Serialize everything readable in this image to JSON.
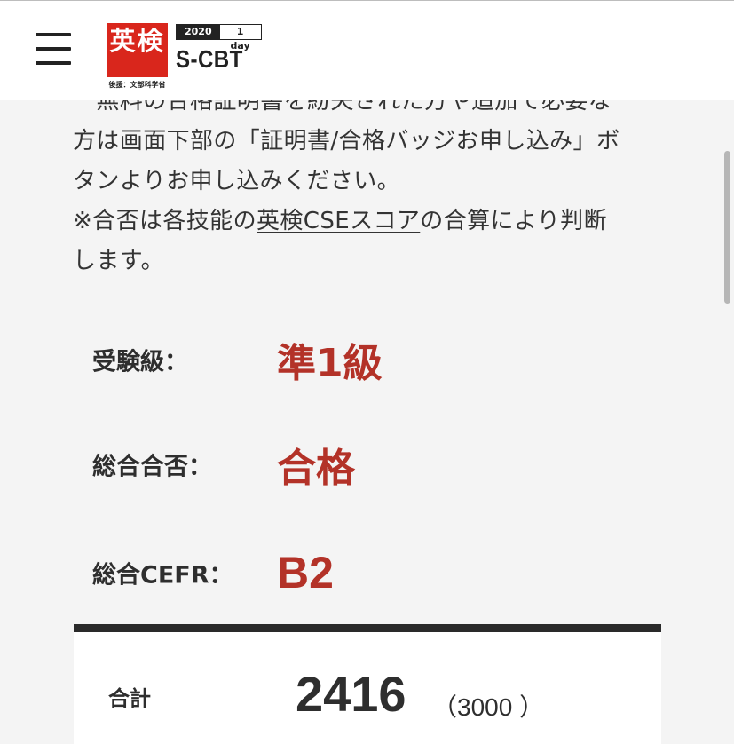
{
  "header": {
    "logo_mark": "英検",
    "logo_sub": "後援：文部科学省",
    "badge_year": "2020",
    "badge_day": "1 day",
    "product_name": "S-CBT"
  },
  "notice": {
    "line1": "　無料の合格証明書を紛失された方や追加で必要な",
    "line2": "方は画面下部の「証明書/合格バッジお申し込み」ボ",
    "line3": "タンよりお申し込みください。",
    "line4_pre": "※合否は各技能の",
    "line4_link": "英検CSEスコア",
    "line4_post": "の合算により判断",
    "line5": "します。"
  },
  "results": {
    "grade_label": "受験級：",
    "grade_value": "準1級",
    "pass_label": "総合合否：",
    "pass_value": "合格",
    "cefr_label": "総合CEFR：",
    "cefr_value": "B2"
  },
  "score": {
    "label": "合計",
    "value": "2416",
    "max": "（3000 ）"
  },
  "colors": {
    "brand_red": "#d9261c",
    "result_red": "#b33228",
    "text_dark": "#2e2e2e"
  }
}
